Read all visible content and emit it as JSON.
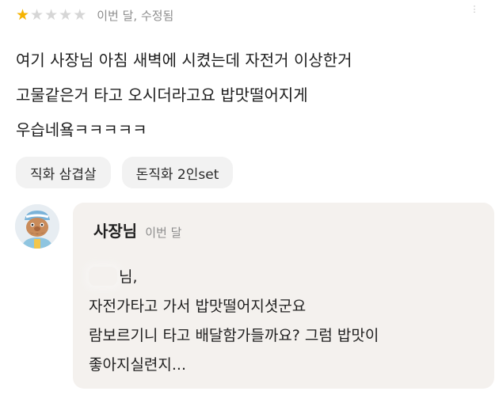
{
  "review": {
    "rating": 1,
    "max_rating": 5,
    "meta": "이번 달, 수정됨",
    "star_on_color": "#f5b301",
    "star_off_color": "#d6d6d6",
    "lines": [
      "여기 사장님 아침 새벽에 시켰는데 자전거 이상한거",
      "고물같은거 타고 오시더라고요 밥맛떨어지게",
      "우습네욬ㅋㅋㅋㅋㅋ"
    ],
    "tags": [
      "직화 삼겹살",
      "돈직화 2인set"
    ]
  },
  "reply": {
    "author": "사장님",
    "date": "이번 달",
    "greeting_suffix": "님,",
    "lines": [
      "자전가타고 가서 밥맛떨어지셧군요",
      "람보르기니 타고 배달함가들까요? 그럼 밥맛이",
      "좋아지실련지..."
    ],
    "background": "#f4f1ee"
  },
  "icons": {
    "more": "more-options-icon",
    "avatar": "owner-avatar-icon"
  }
}
